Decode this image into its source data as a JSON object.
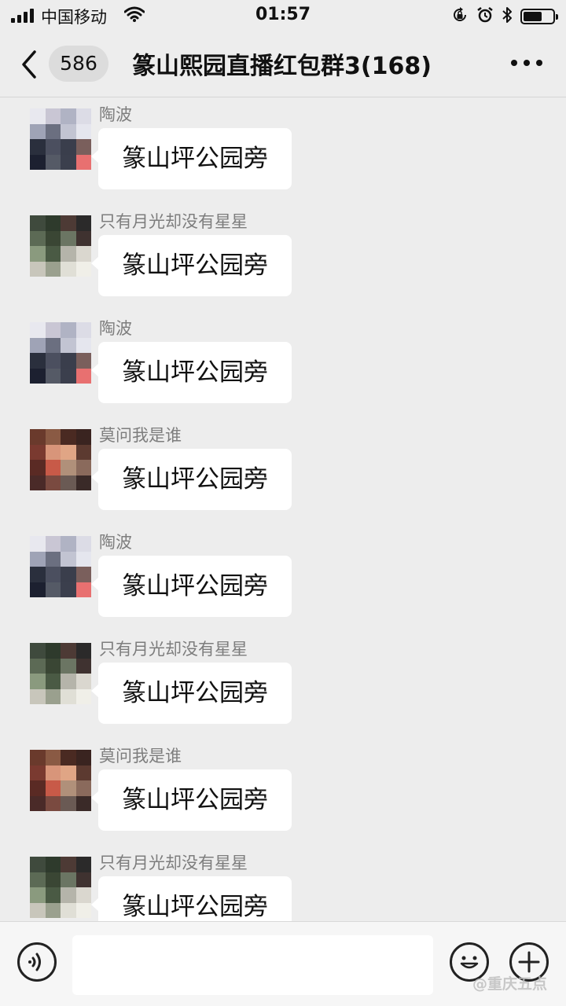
{
  "status_bar": {
    "carrier": "中国移动",
    "time": "01:57",
    "battery_level": 0.65,
    "icons": [
      "signal-icon",
      "wifi-icon",
      "rotation-lock-icon",
      "alarm-icon",
      "bluetooth-icon",
      "battery-icon"
    ]
  },
  "nav": {
    "unread_count": "586",
    "title": "篆山熙园直播红包群3(168)",
    "icons": [
      "back-arrow-icon",
      "more-dots-icon"
    ]
  },
  "colors": {
    "page_bg": "#ededed",
    "bubble_bg": "#ffffff",
    "sender_name": "#7d7d7d",
    "input_bar_bg": "#f6f6f6"
  },
  "messages": [
    {
      "sender": "陶波",
      "text": "篆山坪公园旁"
    },
    {
      "sender": "只有月光却没有星星",
      "text": "篆山坪公园旁"
    },
    {
      "sender": "陶波",
      "text": "篆山坪公园旁"
    },
    {
      "sender": "莫问我是谁",
      "text": "篆山坪公园旁"
    },
    {
      "sender": "陶波",
      "text": "篆山坪公园旁"
    },
    {
      "sender": "只有月光却没有星星",
      "text": "篆山坪公园旁"
    },
    {
      "sender": "莫问我是谁",
      "text": "篆山坪公园旁"
    },
    {
      "sender": "只有月光却没有星星",
      "text": "篆山坪公园旁"
    }
  ],
  "input_bar": {
    "input_value": "",
    "icons": [
      "voice-icon",
      "emoji-icon",
      "plus-icon"
    ]
  }
}
